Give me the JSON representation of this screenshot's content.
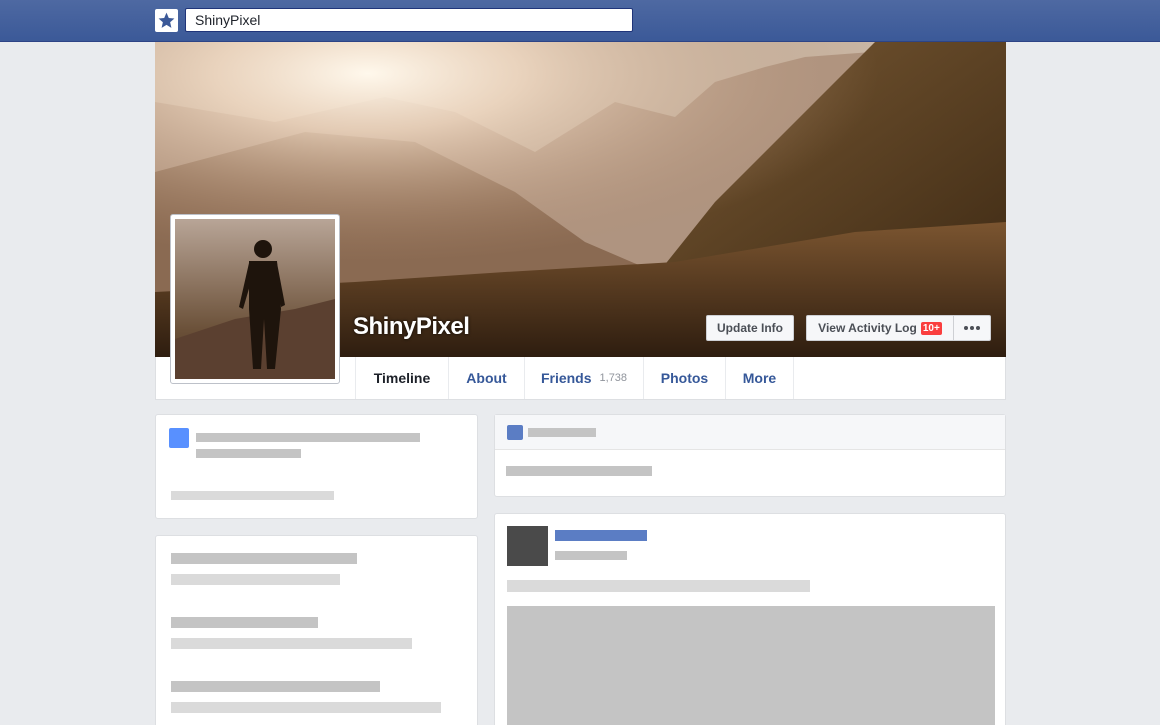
{
  "search": {
    "value": "ShinyPixel"
  },
  "profile": {
    "name": "ShinyPixel"
  },
  "buttons": {
    "update_info": "Update Info",
    "activity_log": "View Activity Log",
    "activity_badge": "10+"
  },
  "nav": {
    "timeline": "Timeline",
    "about": "About",
    "friends": "Friends",
    "friends_count": "1,738",
    "photos": "Photos",
    "more": "More"
  },
  "colors": {
    "brand": "#3b5998",
    "link": "#365899",
    "badge": "#fa3e3e"
  }
}
